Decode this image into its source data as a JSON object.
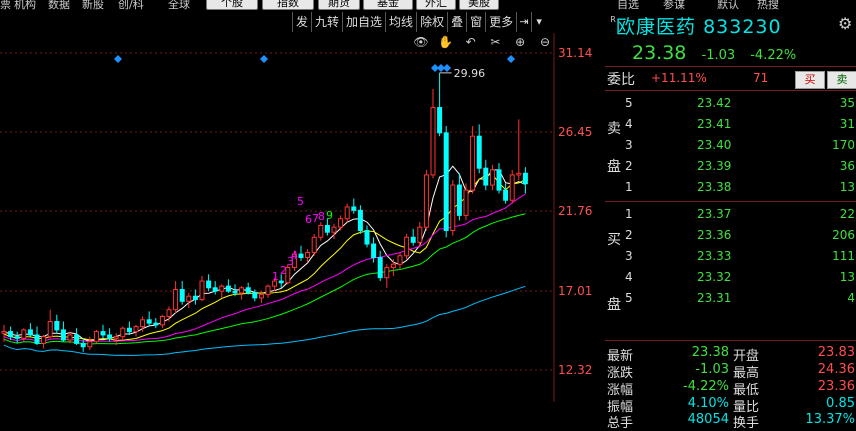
{
  "topnav": {
    "items": [
      "票",
      "机构",
      "数据",
      "新股",
      "创/科",
      "全球"
    ],
    "buttons": [
      "个股",
      "指数",
      "期货",
      "基金",
      "外汇",
      "美股"
    ],
    "right_items": [
      "自选",
      "参谋",
      "默认",
      "热搜"
    ]
  },
  "toolbar": [
    "发",
    "九转",
    "加自选",
    "均线",
    "除权",
    "叠",
    "窗",
    "更多",
    "⇥",
    "▾"
  ],
  "chart_icons": [
    "👁",
    "✋",
    "↶",
    "✂",
    "⊕",
    "⊖"
  ],
  "chart_data": {
    "type": "candlestick",
    "y_ticks": [
      "31.14",
      "26.45",
      "21.76",
      "17.01",
      "12.32"
    ],
    "ylim": [
      12.32,
      31.14
    ],
    "peak_annotation": "29.96",
    "count_labels": [
      "1",
      "2",
      "3",
      "4",
      "5",
      "6",
      "7",
      "8",
      "9"
    ],
    "up_color": "#ff3333",
    "down_color": "#00ffff",
    "ma_colors": [
      "#ffffff",
      "#ffff00",
      "#ff00ff",
      "#00ff00",
      "#00bfff"
    ],
    "candles": [
      [
        14.5,
        15.0,
        14.0,
        14.6
      ],
      [
        14.6,
        14.9,
        14.1,
        14.3
      ],
      [
        14.3,
        14.6,
        13.9,
        14.2
      ],
      [
        14.2,
        14.8,
        14.0,
        14.7
      ],
      [
        14.7,
        15.1,
        14.3,
        14.4
      ],
      [
        14.4,
        14.9,
        13.8,
        13.9
      ],
      [
        13.9,
        14.4,
        13.6,
        14.3
      ],
      [
        14.3,
        15.9,
        14.2,
        15.2
      ],
      [
        15.2,
        15.6,
        14.5,
        14.7
      ],
      [
        14.7,
        15.2,
        14.0,
        14.1
      ],
      [
        14.1,
        14.6,
        13.9,
        14.4
      ],
      [
        14.4,
        14.8,
        13.8,
        13.9
      ],
      [
        13.9,
        14.2,
        13.4,
        13.7
      ],
      [
        13.7,
        14.3,
        13.5,
        14.0
      ],
      [
        14.0,
        14.7,
        13.9,
        14.6
      ],
      [
        14.6,
        15.0,
        14.2,
        14.4
      ],
      [
        14.4,
        14.8,
        14.0,
        14.2
      ],
      [
        14.2,
        14.5,
        13.8,
        14.3
      ],
      [
        14.3,
        14.9,
        14.1,
        14.8
      ],
      [
        14.8,
        15.2,
        14.4,
        14.6
      ],
      [
        14.6,
        15.0,
        14.3,
        14.9
      ],
      [
        14.9,
        15.5,
        14.6,
        15.3
      ],
      [
        15.3,
        15.8,
        14.9,
        15.1
      ],
      [
        15.1,
        15.4,
        14.8,
        15.0
      ],
      [
        15.0,
        15.6,
        14.8,
        15.5
      ],
      [
        15.5,
        16.1,
        15.2,
        15.9
      ],
      [
        15.9,
        17.6,
        15.7,
        17.1
      ],
      [
        17.1,
        17.6,
        16.2,
        16.4
      ],
      [
        16.4,
        16.9,
        16.0,
        16.7
      ],
      [
        16.7,
        17.1,
        16.2,
        16.5
      ],
      [
        16.5,
        17.9,
        16.4,
        17.6
      ],
      [
        17.6,
        18.0,
        17.0,
        17.2
      ],
      [
        17.2,
        17.6,
        16.8,
        17.0
      ],
      [
        17.0,
        17.4,
        16.6,
        17.3
      ],
      [
        17.3,
        17.7,
        16.9,
        17.0
      ],
      [
        17.0,
        17.4,
        16.7,
        16.9
      ],
      [
        16.9,
        17.3,
        16.5,
        17.2
      ],
      [
        17.2,
        17.5,
        16.8,
        16.9
      ],
      [
        16.9,
        17.1,
        16.4,
        16.6
      ],
      [
        16.6,
        17.0,
        16.3,
        16.8
      ],
      [
        16.8,
        17.4,
        16.6,
        17.3
      ],
      [
        17.3,
        17.8,
        17.0,
        17.6
      ],
      [
        17.6,
        18.0,
        17.2,
        17.5
      ],
      [
        17.5,
        18.6,
        17.4,
        18.4
      ],
      [
        18.4,
        19.4,
        18.2,
        19.2
      ],
      [
        19.2,
        19.7,
        18.8,
        19.0
      ],
      [
        19.0,
        19.5,
        18.7,
        19.3
      ],
      [
        19.3,
        20.4,
        19.1,
        20.2
      ],
      [
        20.2,
        21.1,
        20.0,
        20.9
      ],
      [
        20.9,
        21.3,
        20.3,
        20.5
      ],
      [
        20.5,
        21.0,
        20.1,
        20.8
      ],
      [
        20.8,
        21.5,
        20.6,
        21.3
      ],
      [
        21.3,
        22.2,
        21.1,
        22.0
      ],
      [
        22.0,
        22.5,
        21.6,
        21.8
      ],
      [
        21.8,
        22.1,
        20.4,
        20.6
      ],
      [
        20.6,
        20.9,
        19.6,
        19.8
      ],
      [
        19.8,
        20.2,
        18.7,
        19.0
      ],
      [
        19.0,
        19.4,
        17.6,
        17.8
      ],
      [
        17.8,
        18.6,
        17.2,
        18.4
      ],
      [
        18.4,
        18.9,
        17.9,
        18.6
      ],
      [
        18.6,
        19.3,
        18.3,
        19.1
      ],
      [
        19.1,
        20.4,
        18.9,
        20.2
      ],
      [
        20.2,
        20.7,
        19.7,
        19.9
      ],
      [
        19.9,
        21.1,
        19.6,
        20.8
      ],
      [
        20.8,
        24.2,
        20.6,
        23.9
      ],
      [
        23.9,
        29.0,
        23.7,
        27.9
      ],
      [
        27.9,
        29.96,
        26.2,
        26.4
      ],
      [
        26.4,
        26.8,
        20.2,
        20.6
      ],
      [
        20.6,
        23.6,
        20.3,
        23.3
      ],
      [
        23.3,
        24.0,
        21.2,
        21.5
      ],
      [
        21.5,
        23.4,
        21.2,
        23.0
      ],
      [
        23.0,
        26.8,
        22.8,
        26.2
      ],
      [
        26.2,
        26.9,
        24.0,
        24.3
      ],
      [
        24.3,
        24.8,
        23.0,
        23.3
      ],
      [
        23.3,
        24.5,
        23.0,
        24.2
      ],
      [
        24.2,
        24.6,
        22.8,
        23.0
      ],
      [
        23.0,
        23.4,
        22.2,
        22.4
      ],
      [
        22.4,
        24.2,
        22.2,
        23.9
      ],
      [
        23.9,
        27.2,
        23.6,
        24.0
      ],
      [
        24.0,
        24.36,
        22.8,
        23.38
      ]
    ]
  },
  "sidebar_letter": "R",
  "stock": {
    "name": "欧康医药",
    "code": "833230",
    "price": "23.38",
    "change": "-1.03",
    "pct": "-4.22%"
  },
  "weibi": {
    "label": "委比",
    "pct": "+11.11%",
    "diff": "71",
    "buy": "买",
    "sell": "卖"
  },
  "sell_side": {
    "label": [
      "卖",
      "盘"
    ],
    "rows": [
      {
        "level": "5",
        "price": "23.42",
        "vol": "35"
      },
      {
        "level": "4",
        "price": "23.41",
        "vol": "31"
      },
      {
        "level": "3",
        "price": "23.40",
        "vol": "170"
      },
      {
        "level": "2",
        "price": "23.39",
        "vol": "36"
      },
      {
        "level": "1",
        "price": "23.38",
        "vol": "13"
      }
    ]
  },
  "buy_side": {
    "label": [
      "买",
      "盘"
    ],
    "rows": [
      {
        "level": "1",
        "price": "23.37",
        "vol": "22"
      },
      {
        "level": "2",
        "price": "23.36",
        "vol": "206"
      },
      {
        "level": "3",
        "price": "23.33",
        "vol": "111"
      },
      {
        "level": "4",
        "price": "23.32",
        "vol": "13"
      },
      {
        "level": "5",
        "price": "23.31",
        "vol": "4"
      }
    ]
  },
  "stats": [
    {
      "l1": "最新",
      "v1": "23.38",
      "l2": "开盘",
      "v2": "23.83"
    },
    {
      "l1": "涨跌",
      "v1": "-1.03",
      "l2": "最高",
      "v2": "24.36"
    },
    {
      "l1": "涨幅",
      "v1": "-4.22%",
      "l2": "最低",
      "v2": "23.36"
    },
    {
      "l1": "振幅",
      "v1": "4.10%",
      "l2": "量比",
      "v2": "0.85"
    },
    {
      "l1": "总手",
      "v1": "48054",
      "l2": "换手",
      "v2": "13.37%"
    }
  ]
}
